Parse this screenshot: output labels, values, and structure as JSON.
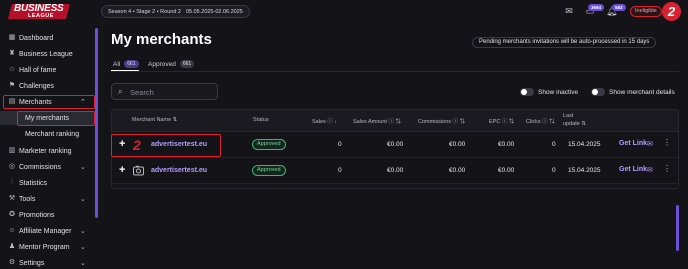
{
  "brand": {
    "line1": "BUSINESS",
    "line2": "LEAGUE"
  },
  "season": {
    "label": "Season 4 • Stage 2 • Round 2",
    "dates": "05.05.2025-02.06.2025"
  },
  "topbar": {
    "mail_icon": "mail-icon",
    "badge1": "3594",
    "bell_icon": "bell-icon",
    "badge2": "583",
    "ineligible": "Ineligible",
    "avatar_initial": "2"
  },
  "sidebar": {
    "items": [
      {
        "label": "Dashboard",
        "icon": "dashboard-icon"
      },
      {
        "label": "Business League",
        "icon": "trophy-icon"
      },
      {
        "label": "Hall of fame",
        "icon": "star-icon"
      },
      {
        "label": "Challenges",
        "icon": "flag-icon"
      },
      {
        "label": "Merchants",
        "icon": "store-icon"
      },
      {
        "label": "My merchants"
      },
      {
        "label": "Merchant ranking"
      },
      {
        "label": "Marketer ranking",
        "icon": "ranking-icon"
      },
      {
        "label": "Commissions",
        "icon": "commission-icon"
      },
      {
        "label": "Statistics",
        "icon": "chart-icon"
      },
      {
        "label": "Tools",
        "icon": "tools-icon"
      },
      {
        "label": "Promotions",
        "icon": "promo-icon"
      },
      {
        "label": "Affiliate Manager",
        "icon": "manager-icon"
      },
      {
        "label": "Mentor Program",
        "icon": "mentor-icon"
      },
      {
        "label": "Settings",
        "icon": "settings-icon"
      }
    ]
  },
  "main": {
    "title": "My merchants",
    "notice": "Pending merchants invitations will be auto-processed in 15 days",
    "tabs": [
      {
        "label": "All",
        "count": "661"
      },
      {
        "label": "Approved",
        "count": "661"
      }
    ],
    "search_placeholder": "Search",
    "toggle_inactive": "Show inactive",
    "toggle_details": "Show merchant details"
  },
  "table": {
    "headers": {
      "name": "Merchant Name",
      "status": "Status",
      "sales": "Sales",
      "sales_amount": "Sales Amount",
      "commissions": "Commissions",
      "epc": "EPC",
      "clicks": "Clicks",
      "last_update_1": "Last",
      "last_update_2": "update"
    },
    "rows": [
      {
        "name": "advertisertest.eu",
        "status": "Approved",
        "sales": "0",
        "sales_amount": "€0.00",
        "commissions": "€0.00",
        "epc": "€0.00",
        "clicks": "0",
        "last_update": "15.04.2025",
        "action": "Get Link"
      },
      {
        "name": "advertisertest.eu",
        "status": "Approved",
        "sales": "0",
        "sales_amount": "€0.00",
        "commissions": "€0.00",
        "epc": "€0.00",
        "clicks": "0",
        "last_update": "15.04.2025",
        "action": "Get Link"
      }
    ]
  }
}
